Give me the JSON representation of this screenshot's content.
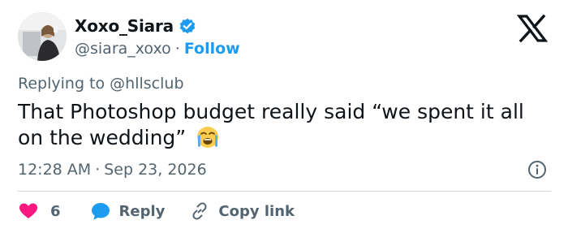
{
  "author": {
    "display_name": "Xoxo_Siara",
    "handle": "@siara_xoxo",
    "separator": "·",
    "follow_label": "Follow",
    "verified_color": "#1d9bf0"
  },
  "tweet": {
    "replying_prefix": "Replying to",
    "replying_handle": "@hllsclub",
    "text": "That Photoshop budget really said “we spent it all on the wedding”",
    "emoji": "loudly-crying-face",
    "time": "12:28 AM",
    "date_separator": "·",
    "date": "Sep 23, 2026"
  },
  "actions": {
    "like_count": "6",
    "reply_label": "Reply",
    "copy_label": "Copy link"
  },
  "colors": {
    "text": "#0f1419",
    "secondary": "#536471",
    "accent": "#1d9bf0",
    "like": "#f91880",
    "divider": "#cfd9de"
  }
}
